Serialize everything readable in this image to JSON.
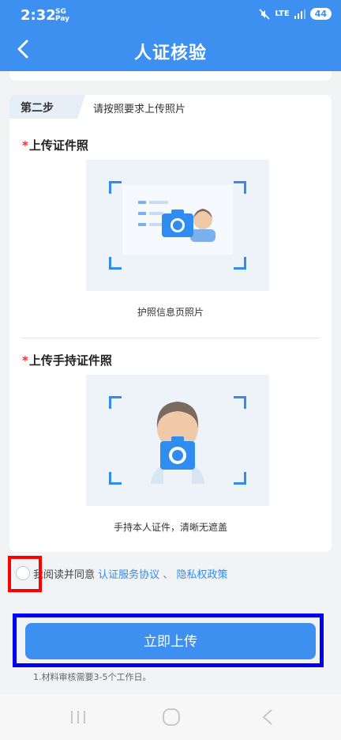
{
  "status": {
    "time": "2:32",
    "net_small_top": "SG",
    "net_small_bottom": "Pay",
    "lte": "LTE",
    "battery": "44"
  },
  "header": {
    "title": "人证核验"
  },
  "step": {
    "tag": "第二步",
    "description": "请按照要求上传照片"
  },
  "uploads": [
    {
      "required_mark": "*",
      "label": "上传证件照",
      "caption": "护照信息页照片"
    },
    {
      "required_mark": "*",
      "label": "上传手持证件照",
      "caption": "手持本人证件，清晰无遮盖"
    }
  ],
  "agreement": {
    "prefix": "我阅读并同意",
    "link1": "认证服务协议",
    "sep": "、",
    "link2": "隐私权政策"
  },
  "submit": {
    "label": "立即上传"
  },
  "note": "1.材料审核需要3-5个工作日。",
  "colors": {
    "primary": "#3d8ff0",
    "annotation_red": "#ff0000",
    "annotation_blue": "#0000ee"
  }
}
